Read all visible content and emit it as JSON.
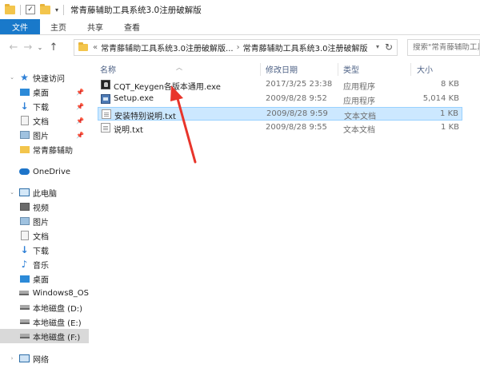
{
  "window": {
    "title": "常青藤辅助工具系统3.0注册破解版",
    "icons": [
      "folder-icon",
      "properties-icon",
      "folder-icon"
    ]
  },
  "ribbon": {
    "tabs": [
      {
        "label": "文件",
        "active": true
      },
      {
        "label": "主页"
      },
      {
        "label": "共享"
      },
      {
        "label": "查看"
      }
    ]
  },
  "nav": {
    "back": "←",
    "forward": "→",
    "recent": "⌄",
    "up": "↑"
  },
  "address": {
    "overflow": "«",
    "segments": [
      "常青藤辅助工具系统3.0注册破解版...",
      "常青藤辅助工具系统3.0注册破解版"
    ],
    "separator": "›"
  },
  "search": {
    "placeholder": "搜索\"常青藤辅助工具系...\""
  },
  "sidebar": {
    "items": [
      {
        "label": "快速访问",
        "icon": "star-icon",
        "level": 0
      },
      {
        "label": "桌面",
        "icon": "desktop-icon",
        "level": 1,
        "pinned": true
      },
      {
        "label": "下载",
        "icon": "download-icon",
        "level": 1,
        "pinned": true
      },
      {
        "label": "文档",
        "icon": "document-icon",
        "level": 1,
        "pinned": true
      },
      {
        "label": "图片",
        "icon": "pictures-icon",
        "level": 1,
        "pinned": true
      },
      {
        "label": "常青藤辅助",
        "icon": "folder-icon",
        "level": 1
      },
      {
        "label": "OneDrive",
        "icon": "onedrive-icon",
        "level": 0
      },
      {
        "label": "此电脑",
        "icon": "this-pc-icon",
        "level": 0
      },
      {
        "label": "视频",
        "icon": "videos-icon",
        "level": 1
      },
      {
        "label": "图片",
        "icon": "pictures-icon",
        "level": 1
      },
      {
        "label": "文档",
        "icon": "document-icon",
        "level": 1
      },
      {
        "label": "下载",
        "icon": "download-icon",
        "level": 1
      },
      {
        "label": "音乐",
        "icon": "music-icon",
        "level": 1
      },
      {
        "label": "桌面",
        "icon": "desktop-icon",
        "level": 1
      },
      {
        "label": "Windows8_OS",
        "icon": "drive-icon",
        "level": 1
      },
      {
        "label": "本地磁盘 (D:)",
        "icon": "drive-icon",
        "level": 1
      },
      {
        "label": "本地磁盘 (E:)",
        "icon": "drive-icon",
        "level": 1
      },
      {
        "label": "本地磁盘 (F:)",
        "icon": "drive-icon",
        "level": 1,
        "selected": true
      },
      {
        "label": "网络",
        "icon": "network-icon",
        "level": 0
      }
    ]
  },
  "columns": {
    "name": "名称",
    "date": "修改日期",
    "type": "类型",
    "size": "大小"
  },
  "files": [
    {
      "name": "CQT_Keygen各版本通用.exe",
      "date": "2017/3/25 23:38",
      "type": "应用程序",
      "size": "8 KB",
      "icon": "keygen-exe-icon"
    },
    {
      "name": "Setup.exe",
      "date": "2009/8/28 9:52",
      "type": "应用程序",
      "size": "5,014 KB",
      "icon": "setup-exe-icon"
    },
    {
      "name": "安装特别说明.txt",
      "date": "2009/8/28 9:59",
      "type": "文本文档",
      "size": "1 KB",
      "icon": "text-file-icon",
      "selected": true
    },
    {
      "name": "说明.txt",
      "date": "2009/8/28 9:55",
      "type": "文本文档",
      "size": "1 KB",
      "icon": "text-file-icon"
    }
  ],
  "annotation": {
    "color": "#e8352b"
  }
}
